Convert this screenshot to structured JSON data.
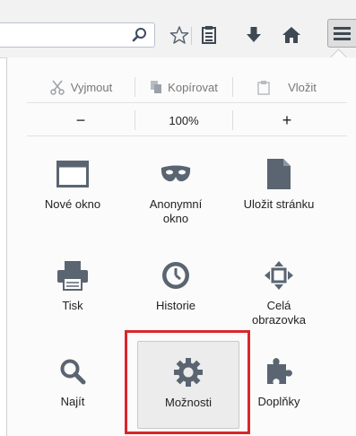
{
  "toolbar": {
    "search_placeholder": "",
    "icons": [
      "search-icon",
      "bookmark-star-icon",
      "reading-list-icon",
      "download-icon",
      "home-icon",
      "hamburger-menu-icon"
    ]
  },
  "edit": {
    "cut_label": "Vyjmout",
    "copy_label": "Kopírovat",
    "paste_label": "Vložit"
  },
  "zoom": {
    "minus_label": "−",
    "level": "100%",
    "plus_label": "+"
  },
  "items": [
    {
      "label": "Nové okno",
      "icon": "new-window-icon"
    },
    {
      "label": "Anonymní okno",
      "icon": "private-mask-icon"
    },
    {
      "label": "Uložit stránku",
      "icon": "save-page-icon"
    },
    {
      "label": "Tisk",
      "icon": "print-icon"
    },
    {
      "label": "Historie",
      "icon": "history-clock-icon"
    },
    {
      "label": "Celá obrazovka",
      "icon": "fullscreen-icon"
    },
    {
      "label": "Najít",
      "icon": "find-magnifier-icon"
    },
    {
      "label": "Možnosti",
      "icon": "options-gear-icon"
    },
    {
      "label": "Doplňky",
      "icon": "addons-puzzle-icon"
    }
  ],
  "colors": {
    "accent_icon": "#5a6571",
    "highlight": "#d9262c",
    "toolbar_bg": "#f2f2f2"
  }
}
